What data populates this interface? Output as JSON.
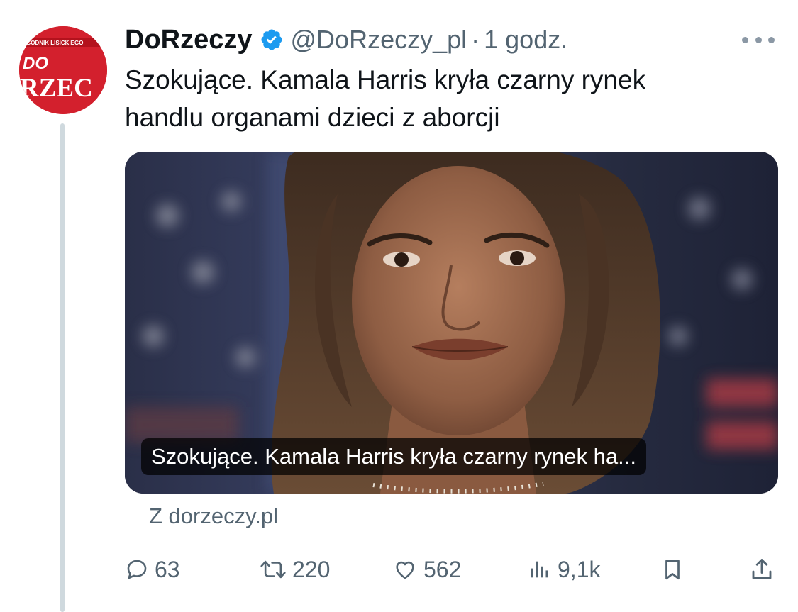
{
  "tweet": {
    "author": {
      "display_name": "DoRzeczy",
      "handle": "@DoRzeczy_pl",
      "separator": "·",
      "time": "1 godz.",
      "avatar_text": {
        "top": "GODNIK LISICKIEGO",
        "mid": "DO",
        "bottom": "RZEC"
      },
      "verified_icon": "verified-badge-icon"
    },
    "text_lines": [
      "Szokujące. Kamala Harris kryła czarny rynek",
      "handlu organami dzieci z aborcji"
    ],
    "card": {
      "caption": "Szokujące. Kamala Harris kryła czarny rynek ha...",
      "source": "Z dorzeczy.pl"
    },
    "actions": {
      "reply": {
        "icon": "reply-icon",
        "count": "63"
      },
      "retweet": {
        "icon": "retweet-icon",
        "count": "220"
      },
      "like": {
        "icon": "heart-icon",
        "count": "562"
      },
      "views": {
        "icon": "views-icon",
        "count": "9,1k"
      },
      "bookmark": {
        "icon": "bookmark-icon"
      },
      "share": {
        "icon": "share-icon"
      }
    }
  },
  "colors": {
    "text_primary": "#0f1419",
    "text_secondary": "#536471",
    "verified_blue": "#1d9bf0",
    "avatar_red": "#d3202d",
    "thread_line": "#cfd9de"
  }
}
